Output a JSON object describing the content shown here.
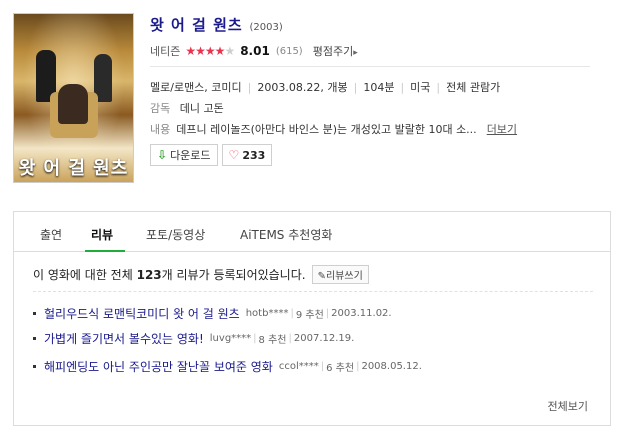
{
  "movie": {
    "poster_title": "왓 어 걸 원츠",
    "title": "왓 어 걸 원츠",
    "year": "(2003)",
    "rating_label": "네티즌",
    "stars_filled": 4,
    "stars_total": 5,
    "score": "8.01",
    "count": "(615)",
    "rate_link": "평점주기",
    "meta": [
      "멜로/로맨스, 코미디",
      "2003.08.22, 개봉",
      "104분",
      "미국",
      "전체 관람가"
    ],
    "director_label": "감독",
    "director": "데니 고돈",
    "summary_label": "내용",
    "summary": "데프니 레이놀즈(아만다 바인스 분)는 개성있고 발랄한 10대 소...",
    "more_link": "더보기",
    "download_label": "다운로드",
    "likes": "233"
  },
  "tabs": [
    {
      "label": "출연"
    },
    {
      "label": "리뷰"
    },
    {
      "label": "포토/동영상"
    },
    {
      "label": "AiTEMS 추천영화"
    }
  ],
  "reviews_summary": {
    "prefix": "이 영화에 대한 전체",
    "count": "123",
    "suffix": "개 리뷰가 등록되어있습니다.",
    "write_label": "리뷰쓰기"
  },
  "reviews": [
    {
      "title": "헐리우드식 로맨틱코미디 왓 어 걸 원츠",
      "user": "hotb****",
      "recommend": "9 추천",
      "date": "2003.11.02."
    },
    {
      "title": "가볍게 즐기면서 볼수있는 영화!",
      "user": "luvg****",
      "recommend": "8 추천",
      "date": "2007.12.19."
    },
    {
      "title": "해피엔딩도 아닌 주인공만 잘난꼴 보여준 영화",
      "user": "ccol****",
      "recommend": "6 추천",
      "date": "2008.05.12."
    }
  ],
  "all_link": "전체보기",
  "colors": {
    "accent": "#1fae3c",
    "star": "#e8344e",
    "link": "#1a1a8c"
  }
}
